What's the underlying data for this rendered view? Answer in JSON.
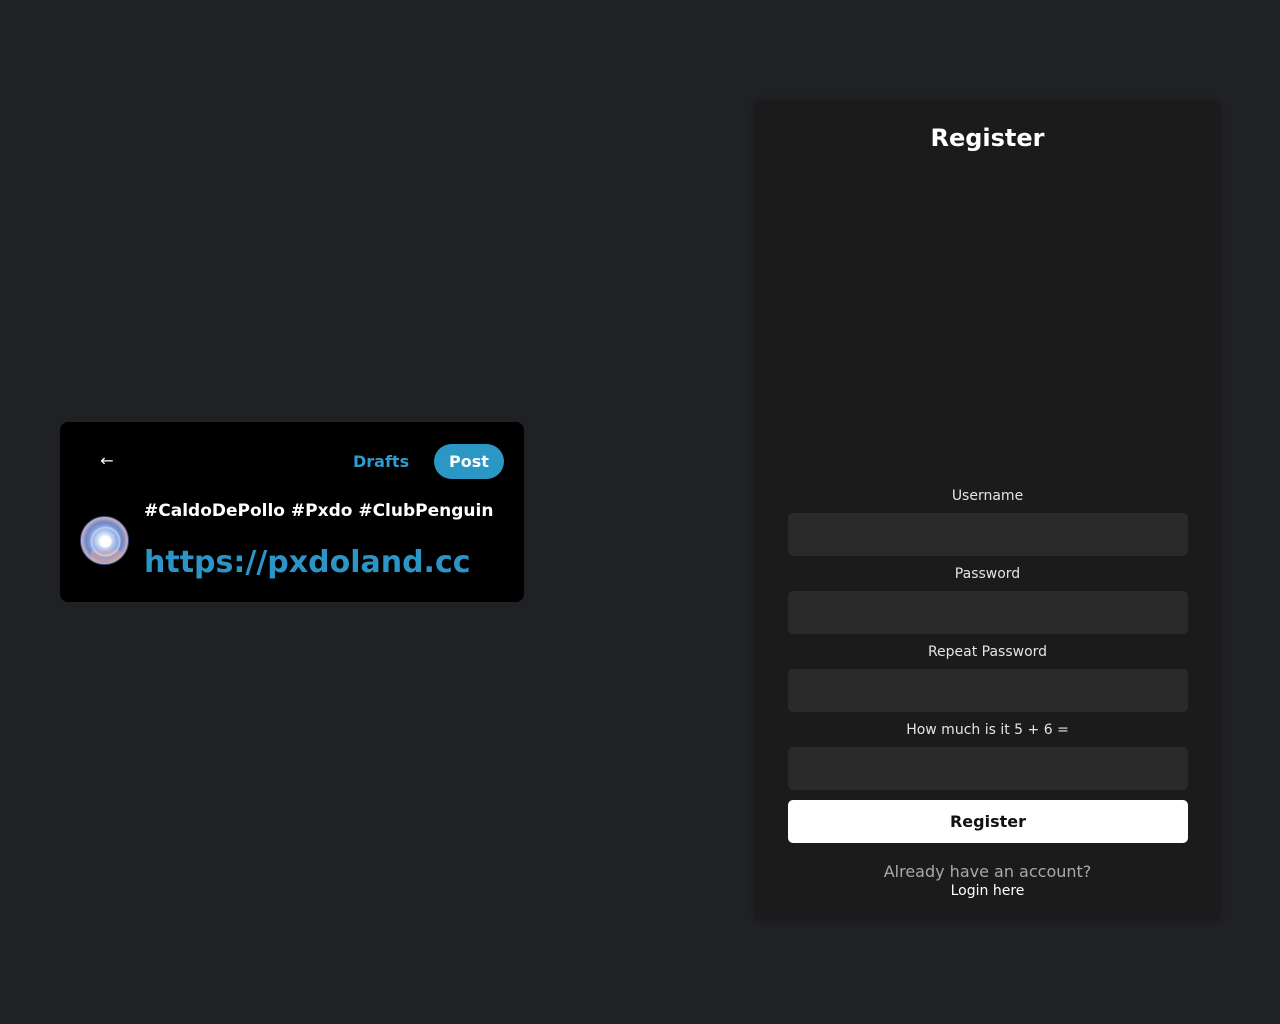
{
  "compose": {
    "back_label": "←",
    "drafts_label": "Drafts",
    "post_label": "Post",
    "post_text": "#CaldoDePollo #Pxdo #ClubPenguin",
    "post_link": "https://pxdoland.cc"
  },
  "register": {
    "title": "Register",
    "fields": [
      {
        "label": "Username",
        "value": "",
        "placeholder": ""
      },
      {
        "label": "Password",
        "value": "",
        "placeholder": ""
      },
      {
        "label": "Repeat Password",
        "value": "",
        "placeholder": ""
      },
      {
        "label": "How much is it 5 + 6 =",
        "value": "",
        "placeholder": ""
      }
    ],
    "submit_label": "Register",
    "already_text": "Already have an account?",
    "login_label": "Login here"
  },
  "colors": {
    "background": "#202124",
    "accent": "#2b97c4",
    "panel": "#1b1b1c",
    "input": "#2a2a2b"
  }
}
